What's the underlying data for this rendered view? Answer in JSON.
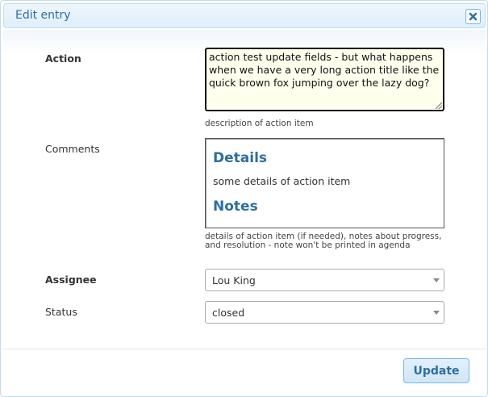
{
  "dialog": {
    "title": "Edit entry",
    "close_icon": "close-icon"
  },
  "form": {
    "action": {
      "label": "Action",
      "value": "action test update fields - but what happens when we have a very long action title like the quick brown fox jumping over the lazy dog?",
      "help": "description of action item"
    },
    "comments": {
      "label": "Comments",
      "heading1": "Details",
      "paragraph1": "some details of action item",
      "heading2": "Notes",
      "help": "details of action item (if needed), notes about progress, and resolution - note won't be printed in agenda"
    },
    "assignee": {
      "label": "Assignee",
      "value": "Lou King"
    },
    "status": {
      "label": "Status",
      "value": "closed"
    }
  },
  "footer": {
    "update_label": "Update"
  },
  "colors": {
    "accent": "#2e6e9e",
    "border": "#c5dbec",
    "action_bg": "#ffffee"
  }
}
